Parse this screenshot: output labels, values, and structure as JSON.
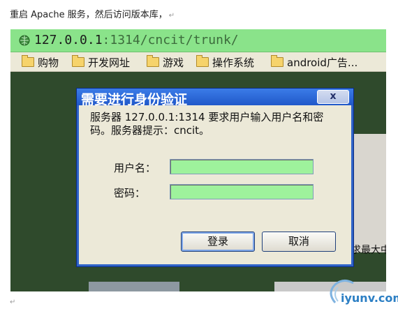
{
  "document": {
    "instruction": "重启 Apache 服务，然后访问版本库，",
    "paragraph_mark": "↵"
  },
  "browser": {
    "url_host": "127.0.0.1",
    "url_path": ":1314/cncit/trunk/",
    "bookmarks": [
      "购物",
      "开发网址",
      "游戏",
      "操作系统",
      "android广告..."
    ]
  },
  "background": {
    "partial_text": "求最大中"
  },
  "dialog": {
    "title": "需要进行身份验证",
    "close_label": "x",
    "message": "服务器 127.0.0.1:1314 要求用户输入用户名和密码。服务器提示：cncit。",
    "username_label": "用户名：",
    "username_value": "",
    "password_label": "密码：",
    "password_value": "",
    "login_label": "登录",
    "cancel_label": "取消"
  },
  "watermark": {
    "text": "iyunv.com"
  }
}
